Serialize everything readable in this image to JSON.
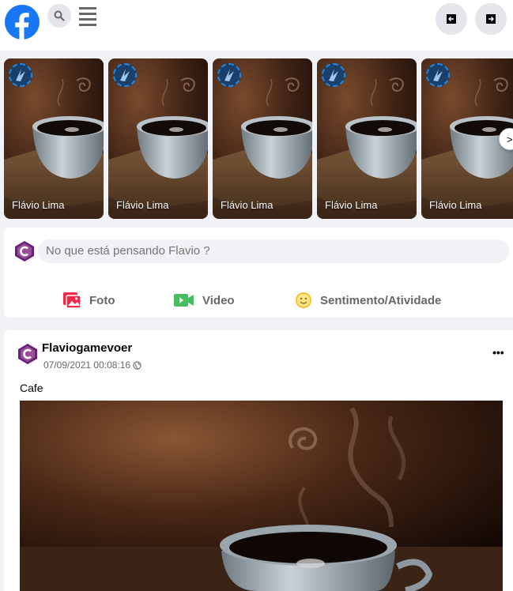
{
  "header": {
    "logo_icon": "facebook-logo-icon",
    "search_icon": "search-icon",
    "menu_icon": "hamburger-menu-icon",
    "left_button_icon": "arrow-left-icon",
    "right_button_icon": "arrow-right-icon"
  },
  "stories": {
    "items": [
      {
        "name": "Flávio Lima"
      },
      {
        "name": "Flávio Lima"
      },
      {
        "name": "Flávio Lima"
      },
      {
        "name": "Flávio Lima"
      },
      {
        "name": "Flávio Lima"
      }
    ],
    "next_label": ">"
  },
  "composer": {
    "placeholder": "No que está pensando Flavio ?",
    "actions": [
      {
        "label": "Foto",
        "icon": "photo-icon",
        "color": "#f02849"
      },
      {
        "label": "Video",
        "icon": "video-camera-icon",
        "color": "#45bd62"
      },
      {
        "label": "Sentimento/Atividade",
        "icon": "smiley-icon",
        "color": "#f7b928"
      }
    ]
  },
  "post": {
    "author": "Flaviogamevoer",
    "timestamp": "07/09/2021 00:08:16",
    "text": "Cafe",
    "more_label": "•••"
  },
  "colors": {
    "brand": "#1877f2",
    "page_bg": "#f0f2f5",
    "avatar_purple": "#68217a"
  }
}
